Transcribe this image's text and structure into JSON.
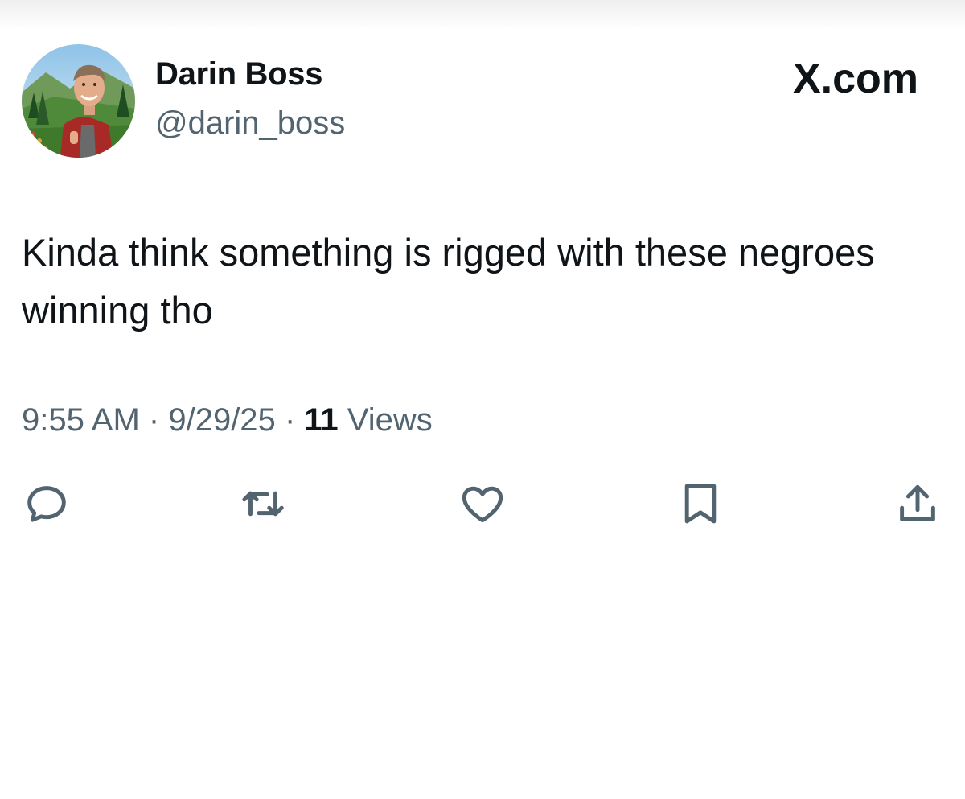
{
  "tweet": {
    "display_name": "Darin Boss",
    "handle": "@darin_boss",
    "text": "Kinda think something is rigged with these negroes winning tho",
    "time": "9:55 AM",
    "date": "9/29/25",
    "separator": "·",
    "views_count": "11",
    "views_label": "Views"
  },
  "brand": {
    "label": "X.com"
  },
  "actions": [
    {
      "name": "reply",
      "icon": "reply-icon"
    },
    {
      "name": "retweet",
      "icon": "retweet-icon"
    },
    {
      "name": "like",
      "icon": "heart-icon"
    },
    {
      "name": "bookmark",
      "icon": "bookmark-icon"
    },
    {
      "name": "share",
      "icon": "share-icon"
    }
  ],
  "colors": {
    "text_primary": "#0f1419",
    "text_secondary": "#536471",
    "background": "#ffffff"
  }
}
